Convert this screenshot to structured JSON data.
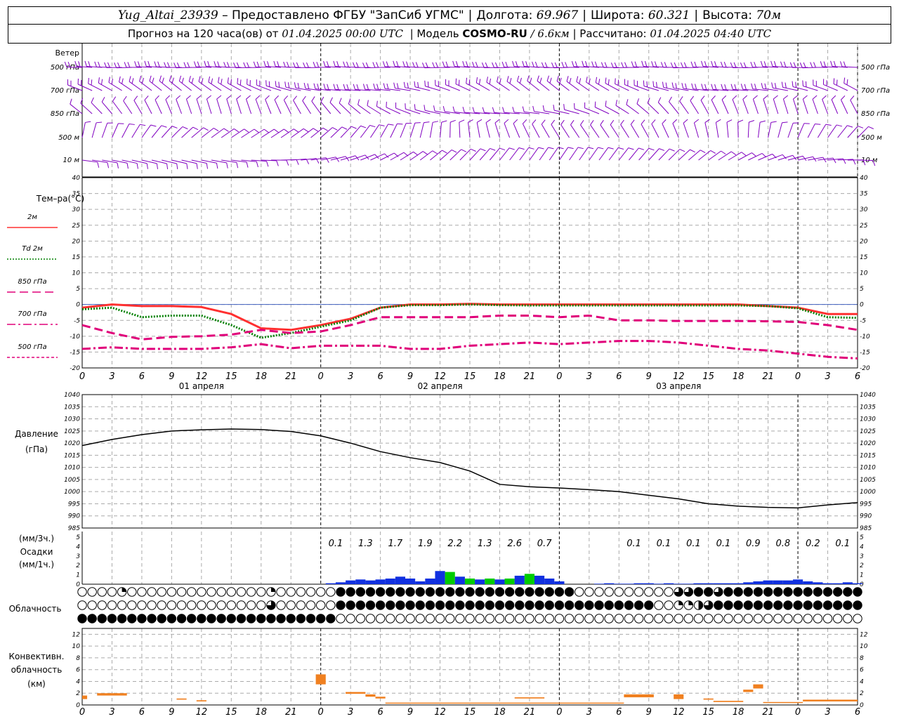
{
  "header": {
    "station": "Yug_Altai_23939",
    "provider": "– Предоставлено ФГБУ \"ЗапСиб УГМС\"",
    "lon_label": "Долгота:",
    "lon": "69.967",
    "lat_label": "Широта:",
    "lat": "60.321",
    "alt_label": "Высота:",
    "alt": "70м",
    "forecast_prefix": "Прогноз на 120 часа(ов) от",
    "forecast_start": "01.04.2025 00:00 UTC",
    "model_prefix": "| Модель",
    "model_name": "COSMO-RU",
    "model_res": "/ 6.6км",
    "calc_prefix": "| Рассчитано:",
    "calc_time": "01.04.2025 04:40 UTC"
  },
  "time_axis": {
    "hour_labels": [
      "0",
      "3",
      "6",
      "9",
      "12",
      "15",
      "18",
      "21",
      "0",
      "3",
      "6",
      "9",
      "12",
      "15",
      "18",
      "21",
      "0",
      "3",
      "6",
      "9",
      "12",
      "15",
      "18",
      "21",
      "0",
      "3",
      "6"
    ],
    "day_labels": [
      "01 апреля",
      "02 апреля",
      "03 апреля"
    ]
  },
  "wind_panel": {
    "title": "Ветер",
    "levels": [
      "500 гПа",
      "700 гПа",
      "850 гПа",
      "500 м",
      "10 м"
    ],
    "color": "#8000c0"
  },
  "chart_data": [
    {
      "type": "line",
      "panel": "temperature",
      "title": "Тем–ра(°C)",
      "ylim": [
        -20,
        40
      ],
      "yticks": [
        "40",
        "35",
        "30",
        "25",
        "20",
        "15",
        "10",
        "5",
        "0",
        "-5",
        "-10",
        "-15",
        "-20"
      ],
      "grid": true,
      "x_hours": [
        0,
        3,
        6,
        9,
        12,
        15,
        18,
        21,
        24,
        27,
        30,
        33,
        36,
        39,
        42,
        45,
        48,
        51,
        54,
        57,
        60,
        63,
        66,
        69,
        72,
        75,
        78
      ],
      "series": [
        {
          "name": "2м",
          "color": "#ff3030",
          "style": "solid",
          "values": [
            -1,
            0,
            -0.5,
            -0.5,
            -0.8,
            -3,
            -7.5,
            -8,
            -6.5,
            -4.5,
            -1,
            0,
            0,
            0.2,
            0,
            0,
            0,
            0,
            0,
            0,
            0,
            0,
            0,
            -0.5,
            -1,
            -3,
            -3
          ]
        },
        {
          "name": "Td 2м",
          "color": "#008000",
          "style": "dotted",
          "values": [
            -1.5,
            -1,
            -4,
            -3.5,
            -3.5,
            -6.5,
            -10.5,
            -9,
            -7,
            -5,
            -1,
            -0.2,
            -0.2,
            0,
            -0.2,
            -0.3,
            -0.3,
            -0.3,
            -0.3,
            -0.3,
            -0.3,
            -0.3,
            -0.3,
            -0.5,
            -1.2,
            -4,
            -4.2
          ]
        },
        {
          "name": "850 гПа",
          "color": "#e0007a",
          "style": "dashed",
          "values": [
            -6.5,
            -9,
            -11,
            -10.2,
            -10,
            -9.5,
            -8,
            -9,
            -8.5,
            -6.5,
            -4,
            -4,
            -4,
            -4,
            -3.5,
            -3.5,
            -4,
            -3.5,
            -5,
            -5,
            -5.2,
            -5.2,
            -5.2,
            -5.3,
            -5.5,
            -6.5,
            -8
          ]
        },
        {
          "name": "700 гПа",
          "color": "#e0007a",
          "style": "dashdot",
          "values": [
            -14,
            -13.5,
            -14,
            -14,
            -14,
            -13.5,
            -12.5,
            -13.8,
            -13,
            -13,
            -13,
            -14,
            -14,
            -13,
            -12.5,
            -12,
            -12.5,
            -12,
            -11.5,
            -11.5,
            -12,
            -13,
            -14,
            -14.5,
            -15.5,
            -16.5,
            -17
          ]
        },
        {
          "name": "500 гПа",
          "color": "#e0007a",
          "style": "dashed-fine",
          "values": []
        }
      ]
    },
    {
      "type": "line",
      "panel": "pressure",
      "title": "Давление",
      "ylabel": "(гПа)",
      "ylim": [
        985,
        1040
      ],
      "yticks": [
        "1040",
        "1035",
        "1030",
        "1025",
        "1020",
        "1015",
        "1010",
        "1005",
        "1000",
        "995",
        "990",
        "985"
      ],
      "grid": true,
      "x_hours": [
        0,
        3,
        6,
        9,
        12,
        15,
        18,
        21,
        24,
        27,
        30,
        33,
        36,
        39,
        42,
        45,
        48,
        51,
        54,
        57,
        60,
        63,
        66,
        69,
        72,
        75,
        78
      ],
      "series": [
        {
          "name": "",
          "color": "#000000",
          "values": [
            1019,
            1021.5,
            1023.5,
            1025,
            1025.5,
            1025.8,
            1025.6,
            1024.8,
            1023,
            1020,
            1016.5,
            1014,
            1012,
            1008.5,
            1003,
            1002,
            1001.5,
            1000.8,
            1000,
            998.5,
            997,
            995,
            994,
            993.5,
            993.3,
            994.5,
            995.5
          ]
        }
      ]
    },
    {
      "type": "bar",
      "panel": "precipitation",
      "title": "Осадки",
      "ylabel_left": "(мм/3ч.)",
      "ylabel_right": "(мм/1ч.)",
      "ylim": [
        0,
        5
      ],
      "yticks": [
        "5",
        "4",
        "3",
        "2",
        "1",
        "0"
      ],
      "totals_3h": [
        "0.1",
        "1.3",
        "1.7",
        "1.9",
        "2.2",
        "1.3",
        "2.6",
        "0.7",
        "0.1",
        "0.1",
        "0.1",
        "0.1",
        "0.9",
        "0.8",
        "0.2",
        "0.1"
      ],
      "totals_3h_hours": [
        25.5,
        28.5,
        31.5,
        34.5,
        37.5,
        40.5,
        43.5,
        46.5,
        55.5,
        58.5,
        61.5,
        64.5,
        67.5,
        70.5,
        73.5,
        76.5
      ],
      "x_hours": [
        25,
        26,
        27,
        28,
        29,
        30,
        31,
        32,
        33,
        34,
        35,
        36,
        37,
        38,
        39,
        40,
        41,
        42,
        43,
        44,
        45,
        46,
        47,
        48,
        52,
        53,
        54,
        55,
        56,
        57,
        58,
        59,
        60,
        61,
        62,
        63,
        64,
        65,
        66,
        67,
        68,
        69,
        70,
        71,
        72,
        73,
        74,
        75,
        76,
        77,
        78
      ],
      "values": [
        0.1,
        0.2,
        0.4,
        0.5,
        0.4,
        0.5,
        0.6,
        0.8,
        0.6,
        0.3,
        0.6,
        1.4,
        1.3,
        0.8,
        0.6,
        0.5,
        0.6,
        0.5,
        0.6,
        0.9,
        1.1,
        0.9,
        0.6,
        0.3,
        0.05,
        0.1,
        0.05,
        0.05,
        0.1,
        0.1,
        0.05,
        0.1,
        0.05,
        0.05,
        0.1,
        0.1,
        0.1,
        0.1,
        0.1,
        0.2,
        0.3,
        0.4,
        0.4,
        0.4,
        0.5,
        0.3,
        0.2,
        0.1,
        0.1,
        0.2,
        0.1
      ],
      "colors": {
        "rain": "#1030e0",
        "snow": "#00cc00"
      }
    },
    {
      "type": "bar",
      "panel": "convective_cloud",
      "title": "Конвективн.",
      "title2": "облачность",
      "ylabel": "(км)",
      "ylim": [
        0,
        13
      ],
      "yticks": [
        "12",
        "10",
        "8",
        "6",
        "4",
        "2",
        "0"
      ],
      "color": "#f08020",
      "segments": [
        {
          "x0": 0,
          "x1": 0.5,
          "base": 1.0,
          "top": 1.6
        },
        {
          "x0": 1.5,
          "x1": 4.5,
          "base": 1.6,
          "top": 2.0
        },
        {
          "x0": 9.5,
          "x1": 10.5,
          "base": 0.9,
          "top": 1.1
        },
        {
          "x0": 11.5,
          "x1": 12.5,
          "base": 0.6,
          "top": 0.8
        },
        {
          "x0": 23.5,
          "x1": 24.5,
          "base": 3.5,
          "top": 5.2
        },
        {
          "x0": 26.5,
          "x1": 28.5,
          "base": 1.9,
          "top": 2.2
        },
        {
          "x0": 28.5,
          "x1": 29.5,
          "base": 1.4,
          "top": 1.8
        },
        {
          "x0": 29.5,
          "x1": 30.5,
          "base": 1.1,
          "top": 1.4
        },
        {
          "x0": 30.5,
          "x1": 54.5,
          "base": 0.3,
          "top": 0.4
        },
        {
          "x0": 43.5,
          "x1": 46.5,
          "base": 1.1,
          "top": 1.3
        },
        {
          "x0": 54.5,
          "x1": 57.5,
          "base": 1.3,
          "top": 1.8
        },
        {
          "x0": 59.5,
          "x1": 60.5,
          "base": 1.0,
          "top": 1.8
        },
        {
          "x0": 62.5,
          "x1": 63.5,
          "base": 0.9,
          "top": 1.1
        },
        {
          "x0": 63.5,
          "x1": 66.5,
          "base": 0.5,
          "top": 0.7
        },
        {
          "x0": 66.5,
          "x1": 67.5,
          "base": 2.2,
          "top": 2.6
        },
        {
          "x0": 67.5,
          "x1": 68.5,
          "base": 2.8,
          "top": 3.5
        },
        {
          "x0": 68.5,
          "x1": 72.5,
          "base": 0.4,
          "top": 0.5
        },
        {
          "x0": 72.5,
          "x1": 78,
          "base": 0.6,
          "top": 0.9
        }
      ]
    },
    {
      "type": "table",
      "panel": "cloudiness",
      "title": "Облачность",
      "rows": [
        "00001000000000000001000000444444444444444444444444000000000033443444444444444444440000000000000",
        "00000000000000000003000000444444444444444444444444444444440011234444444444444444444444444442344",
        "44444444444444444444444444000000000000000000000000000000000000000000000000000000000000000000000"
      ]
    }
  ]
}
